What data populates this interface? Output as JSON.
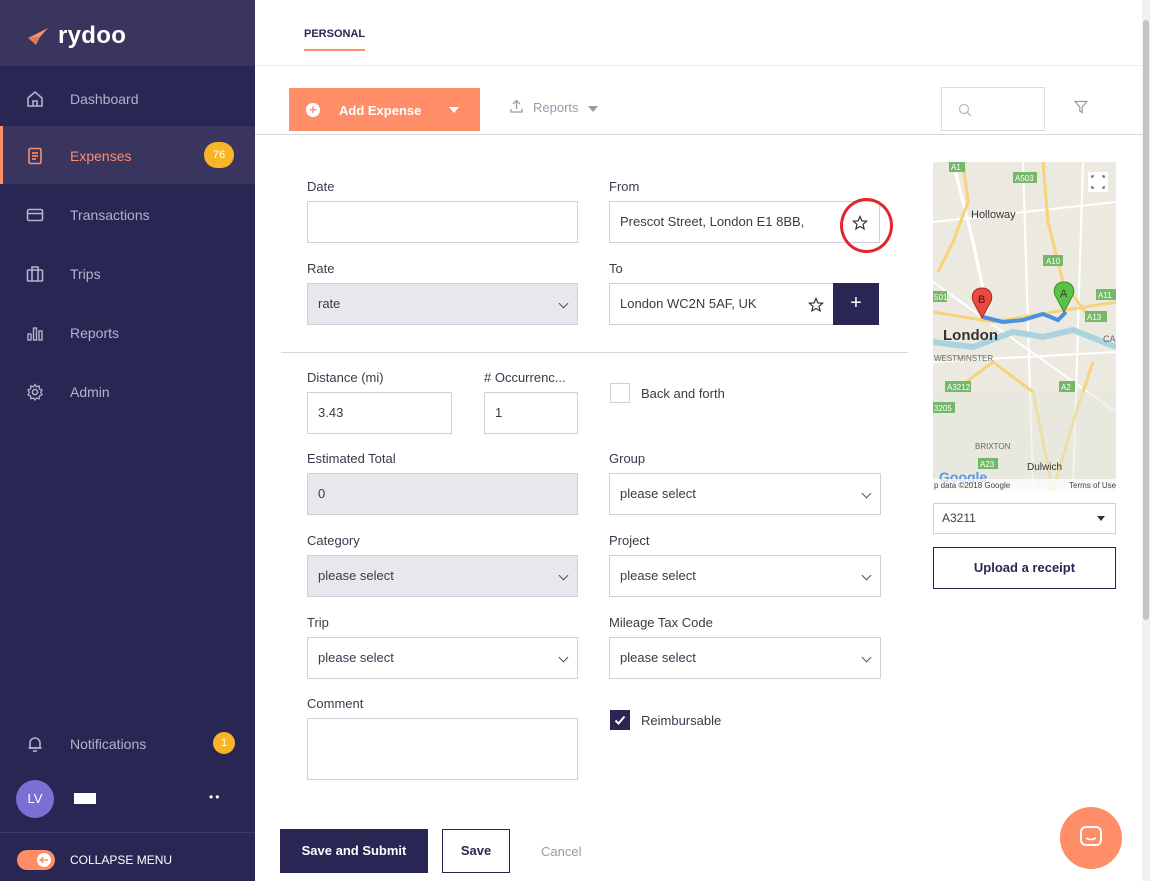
{
  "app": {
    "name": "rydoo",
    "brand_color": "#ff8d67",
    "sidebar_color": "#2a2654"
  },
  "sidebar": {
    "items": [
      {
        "label": "Dashboard",
        "icon": "home-icon"
      },
      {
        "label": "Expenses",
        "icon": "document-icon",
        "badge": "76",
        "active": true
      },
      {
        "label": "Transactions",
        "icon": "credit-card-icon"
      },
      {
        "label": "Trips",
        "icon": "suitcase-icon"
      },
      {
        "label": "Reports",
        "icon": "bar-chart-icon"
      },
      {
        "label": "Admin",
        "icon": "gear-icon"
      }
    ],
    "notifications": {
      "label": "Notifications",
      "badge": "1"
    },
    "user": {
      "initials": "LV",
      "menu": "••"
    },
    "collapse_label": "COLLAPSE MENU"
  },
  "topbar": {
    "tab": "PERSONAL"
  },
  "toolbar": {
    "add_expense": "Add Expense",
    "reports": "Reports",
    "search_placeholder": ""
  },
  "form": {
    "date": {
      "label": "Date",
      "value": ""
    },
    "from": {
      "label": "From",
      "value": "Prescot Street, London E1 8BB,"
    },
    "rate": {
      "label": "Rate",
      "value": "rate"
    },
    "to": {
      "label": "To",
      "value": "London WC2N 5AF, UK"
    },
    "distance": {
      "label": "Distance (mi)",
      "value": "3.43"
    },
    "occurrences": {
      "label": "# Occurrenc...",
      "value": "1"
    },
    "back_and_forth": {
      "label": "Back and forth",
      "checked": false
    },
    "estimated_total": {
      "label": "Estimated Total",
      "value": "0"
    },
    "group": {
      "label": "Group",
      "value": "please select"
    },
    "category": {
      "label": "Category",
      "value": "please select"
    },
    "project": {
      "label": "Project",
      "value": "please select"
    },
    "trip": {
      "label": "Trip",
      "value": "please select"
    },
    "mileage_tax_code": {
      "label": "Mileage Tax Code",
      "value": "please select"
    },
    "comment": {
      "label": "Comment",
      "value": ""
    },
    "reimbursable": {
      "label": "Reimbursable",
      "checked": true
    }
  },
  "map": {
    "labels": {
      "holloway": "Holloway",
      "london": "London",
      "westminster": "WESTMINSTER",
      "brixton": "BRIXTON",
      "dulwich": "Dulwich",
      "a1": "A1",
      "a503": "A503",
      "a10": "A10",
      "a11": "A11",
      "a13": "A13",
      "a501": "501",
      "a3212": "A3212",
      "a3205": "3205",
      "a2": "A2",
      "a23": "A23",
      "ca": "CA"
    },
    "marker_a": "A",
    "marker_b": "B",
    "google": "Google",
    "attribution": "p data ©2018 Google",
    "terms": "Terms of Use",
    "route_select": "A3211"
  },
  "upload_receipt": "Upload a receipt",
  "actions": {
    "save_and_submit": "Save and Submit",
    "save": "Save",
    "cancel": "Cancel"
  }
}
